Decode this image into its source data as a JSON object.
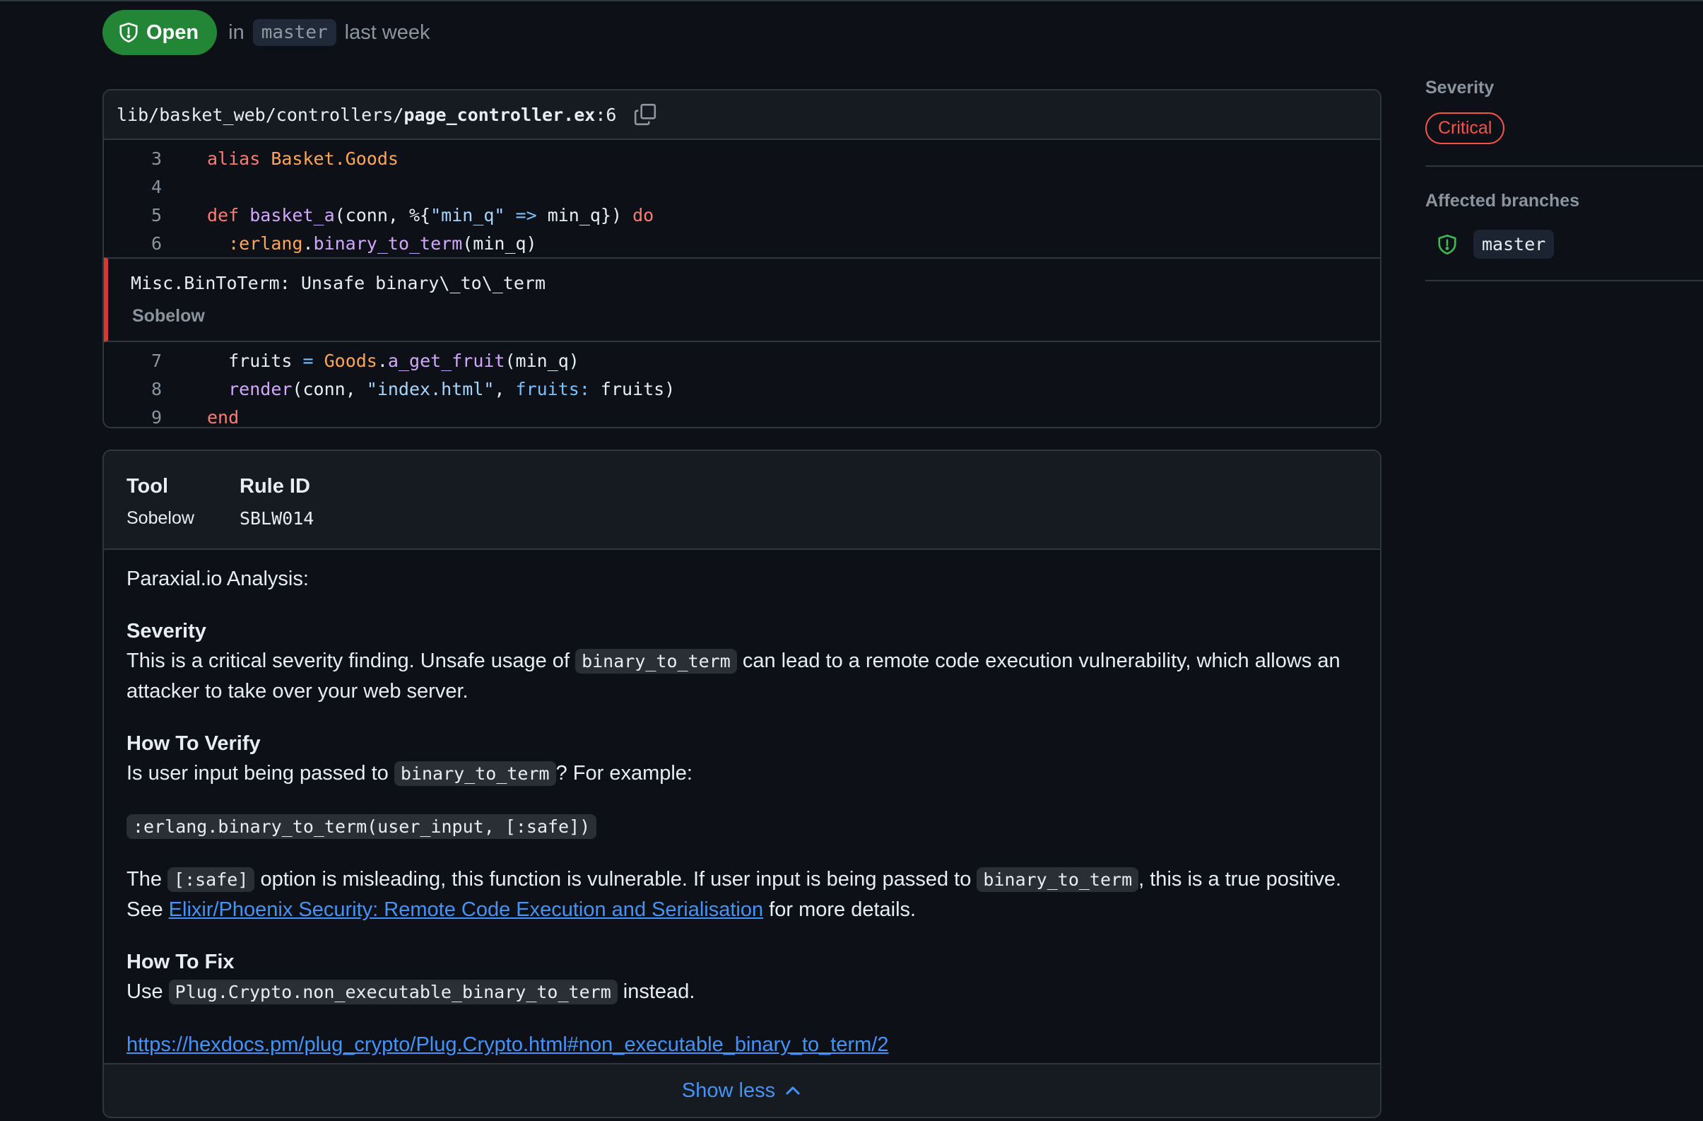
{
  "status": {
    "badge_label": "Open",
    "in_text": "in",
    "branch": "master",
    "time": "last week"
  },
  "code": {
    "path_prefix": "lib/basket_web/controllers/",
    "file_name": "page_controller.ex",
    "line_ref": ":6",
    "lines_before": [
      {
        "n": "3",
        "code": "alias Basket.Goods"
      },
      {
        "n": "4",
        "code": ""
      },
      {
        "n": "5",
        "code": "def basket_a(conn, %{\"min_q\" => min_q}) do"
      },
      {
        "n": "6",
        "code": "  :erlang.binary_to_term(min_q)"
      }
    ],
    "alert_title": "Misc.BinToTerm: Unsafe binary\\_to\\_term",
    "alert_tool": "Sobelow",
    "lines_after": [
      {
        "n": "7",
        "code": "  fruits = Goods.a_get_fruit(min_q)"
      },
      {
        "n": "8",
        "code": "  render(conn, \"index.html\", fruits: fruits)"
      },
      {
        "n": "9",
        "code": "end"
      }
    ]
  },
  "meta": {
    "tool_label": "Tool",
    "tool_value": "Sobelow",
    "rule_label": "Rule ID",
    "rule_value": "SBLW014"
  },
  "description": {
    "intro": "Paraxial.io Analysis:",
    "severity_heading": "Severity",
    "severity_pre": "This is a critical severity finding. Unsafe usage of ",
    "severity_code": "binary_to_term",
    "severity_post": " can lead to a remote code execution vulnerability, which allows an attacker to take over your web server.",
    "verify_heading": "How To Verify",
    "verify_pre": "Is user input being passed to ",
    "verify_code": "binary_to_term",
    "verify_post": "? For example:",
    "example_code": ":erlang.binary_to_term(user_input, [:safe])",
    "safe_pre": "The ",
    "safe_code": "[:safe]",
    "safe_mid": " option is misleading, this function is vulnerable. If user input is being passed to ",
    "safe_code2": "binary_to_term",
    "safe_post": ", this is a true positive.",
    "see_pre": "See ",
    "see_link": "Elixir/Phoenix Security: Remote Code Execution and Serialisation",
    "see_post": " for more details.",
    "fix_heading": "How To Fix",
    "fix_pre": "Use ",
    "fix_code": "Plug.Crypto.non_executable_binary_to_term",
    "fix_post": " instead.",
    "doc_link": "https://hexdocs.pm/plug_crypto/Plug.Crypto.html#non_executable_binary_to_term/2"
  },
  "show_less_label": "Show less",
  "sidebar": {
    "severity_label": "Severity",
    "severity_value": "Critical",
    "branches_label": "Affected branches",
    "branch": "master"
  }
}
